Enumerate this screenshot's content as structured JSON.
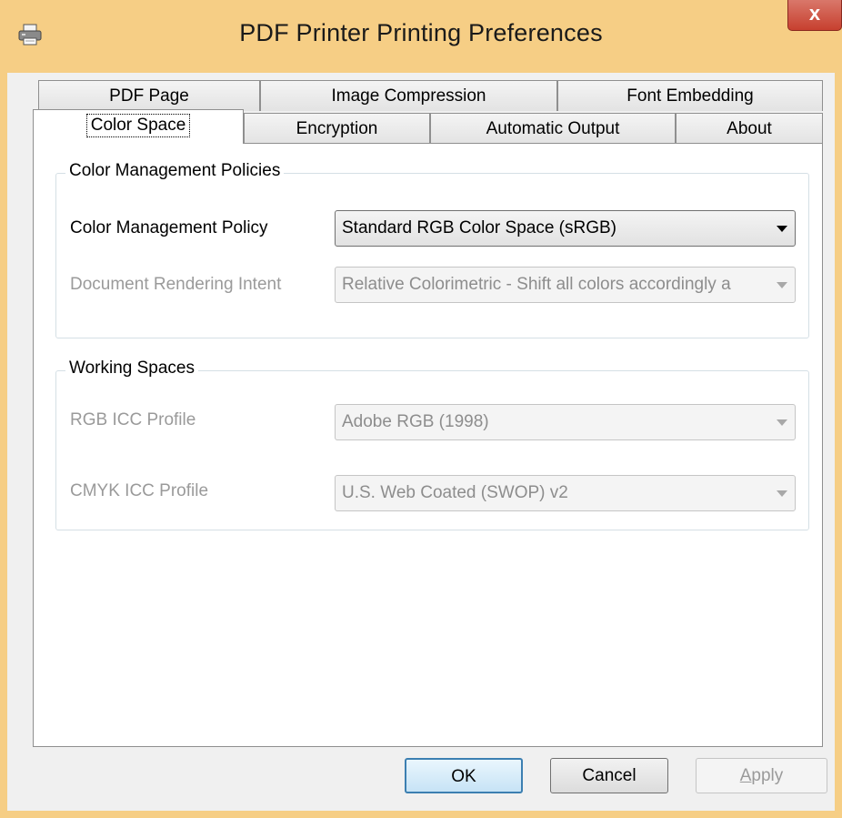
{
  "window": {
    "title": "PDF Printer Printing Preferences",
    "icon": "printer-icon",
    "close_label": "x",
    "frame_color": "#f6ce85",
    "close_color": "#c7402f"
  },
  "tabs": {
    "row1": [
      "PDF Page",
      "Image Compression",
      "Font Embedding"
    ],
    "row2": [
      "Color Space",
      "Encryption",
      "Automatic Output",
      "About"
    ],
    "selected": "Color Space"
  },
  "color_management": {
    "group_title": "Color Management Policies",
    "policy_label": "Color Management Policy",
    "policy_value": "Standard RGB Color Space (sRGB)",
    "intent_label": "Document Rendering Intent",
    "intent_value": "Relative Colorimetric - Shift all colors accordingly a"
  },
  "working_spaces": {
    "group_title": "Working Spaces",
    "rgb_label": "RGB ICC Profile",
    "rgb_value": "Adobe RGB (1998)",
    "cmyk_label": "CMYK ICC Profile",
    "cmyk_value": "U.S. Web Coated (SWOP) v2"
  },
  "buttons": {
    "ok": "OK",
    "cancel": "Cancel",
    "apply_first": "A",
    "apply_rest": "pply"
  }
}
